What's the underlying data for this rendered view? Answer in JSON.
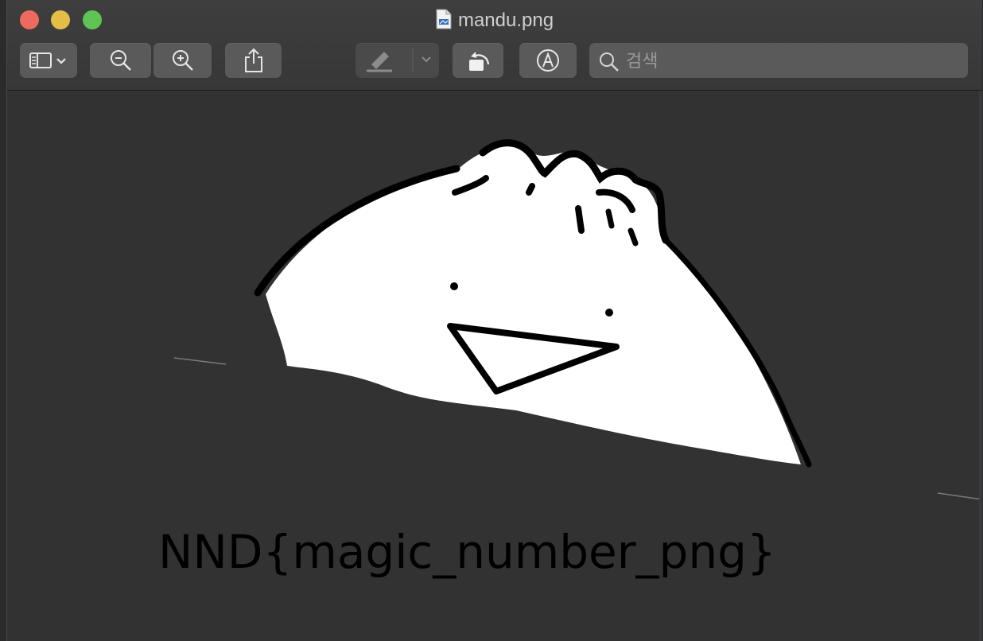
{
  "window": {
    "title": "mandu.png"
  },
  "toolbar": {
    "buttons": [
      {
        "name": "sidebar-toggle",
        "icon": "sidebar-icon"
      },
      {
        "name": "zoom-out",
        "icon": "zoom-out-icon"
      },
      {
        "name": "zoom-in",
        "icon": "zoom-in-icon"
      },
      {
        "name": "share",
        "icon": "share-icon"
      },
      {
        "name": "highlight",
        "icon": "highlighter-icon"
      },
      {
        "name": "rotate",
        "icon": "rotate-left-icon"
      },
      {
        "name": "markup",
        "icon": "markup-icon"
      }
    ],
    "search": {
      "placeholder": "검색",
      "value": ""
    }
  },
  "image": {
    "flag_text": "NND{magic_number_png}"
  },
  "colors": {
    "close": "#ed6a5e",
    "minimize": "#e3bd47",
    "zoom": "#5fc454",
    "canvas": "#323232"
  }
}
